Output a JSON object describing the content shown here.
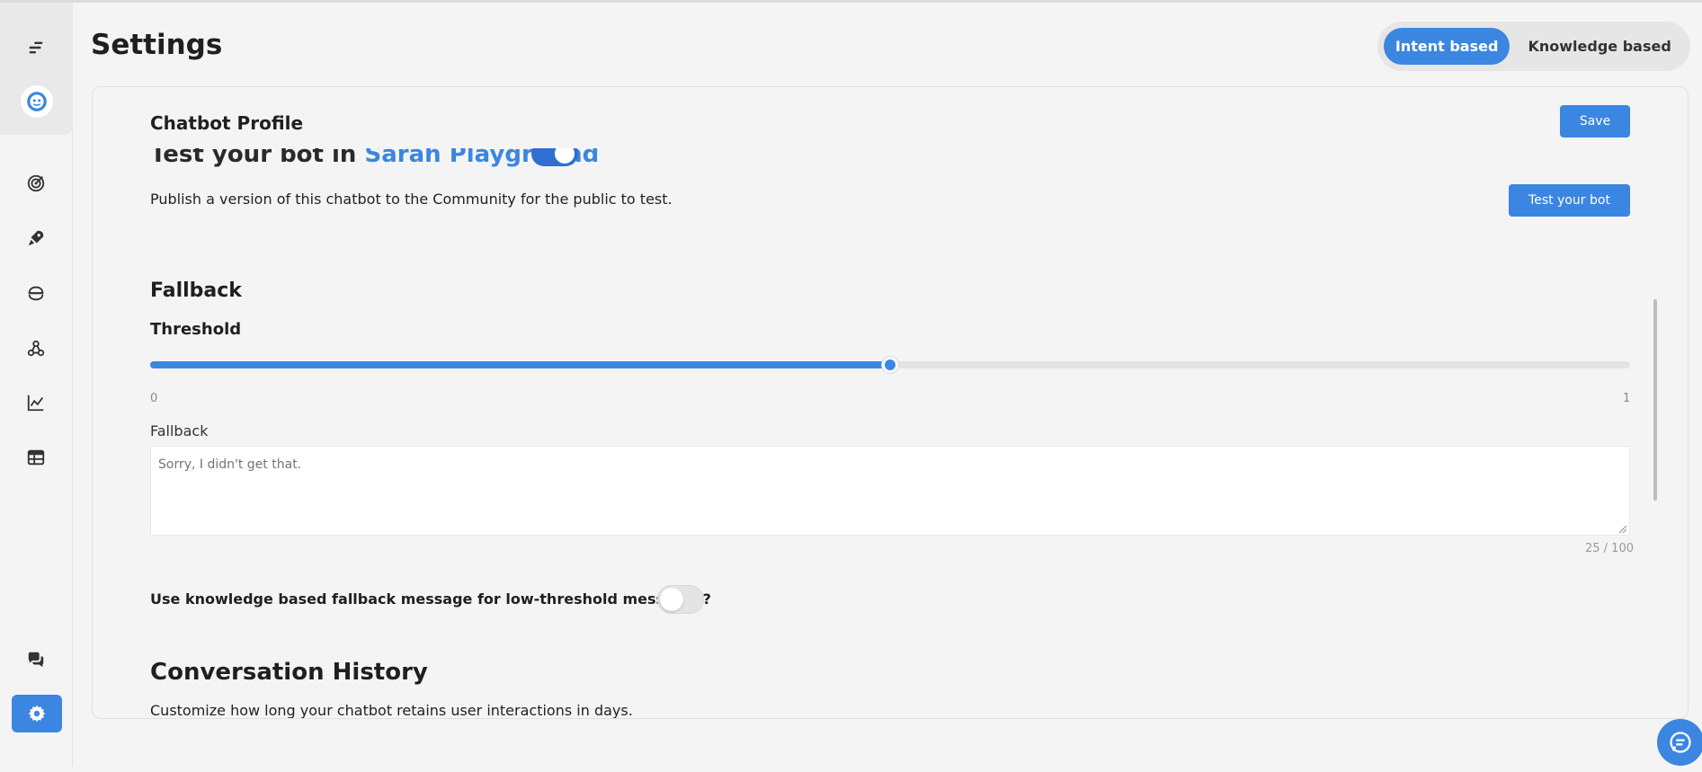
{
  "header": {
    "title": "Settings",
    "mode_tabs": [
      {
        "label": "Intent based",
        "active": true
      },
      {
        "label": "Knowledge based",
        "active": false
      }
    ]
  },
  "sidebar": {
    "items": [
      {
        "icon": "collapse-icon"
      },
      {
        "icon": "bot-logo-icon"
      },
      {
        "icon": "target-icon"
      },
      {
        "icon": "rocket-icon"
      },
      {
        "icon": "switch-icon"
      },
      {
        "icon": "webhook-icon"
      },
      {
        "icon": "analytics-icon"
      },
      {
        "icon": "table-icon"
      },
      {
        "icon": "conversations-icon"
      },
      {
        "icon": "gear-icon",
        "active": true
      }
    ]
  },
  "card": {
    "title": "Chatbot Profile",
    "save_label": "Save",
    "cut_heading_prefix": "Test your bot in ",
    "cut_heading_link": "Sarah Playground",
    "publish_text": "Publish a version of this chatbot to the Community for the public to test.",
    "test_button": "Test your bot",
    "fallback_section_title": "Fallback",
    "threshold_label": "Threshold",
    "slider": {
      "min_label": "0",
      "max_label": "1",
      "value": 0.5
    },
    "fallback_field_label": "Fallback",
    "fallback_placeholder": "Sorry, I didn't get that.",
    "char_count": "25 / 100",
    "kb_fallback_label": "Use knowledge based fallback message for low-threshold messages?",
    "kb_fallback_enabled": false,
    "conversation_history_title": "Conversation History",
    "conversation_history_desc": "Customize how long your chatbot retains user interactions in days."
  },
  "colors": {
    "accent": "#3b86e0",
    "background": "#f4f4f4"
  }
}
